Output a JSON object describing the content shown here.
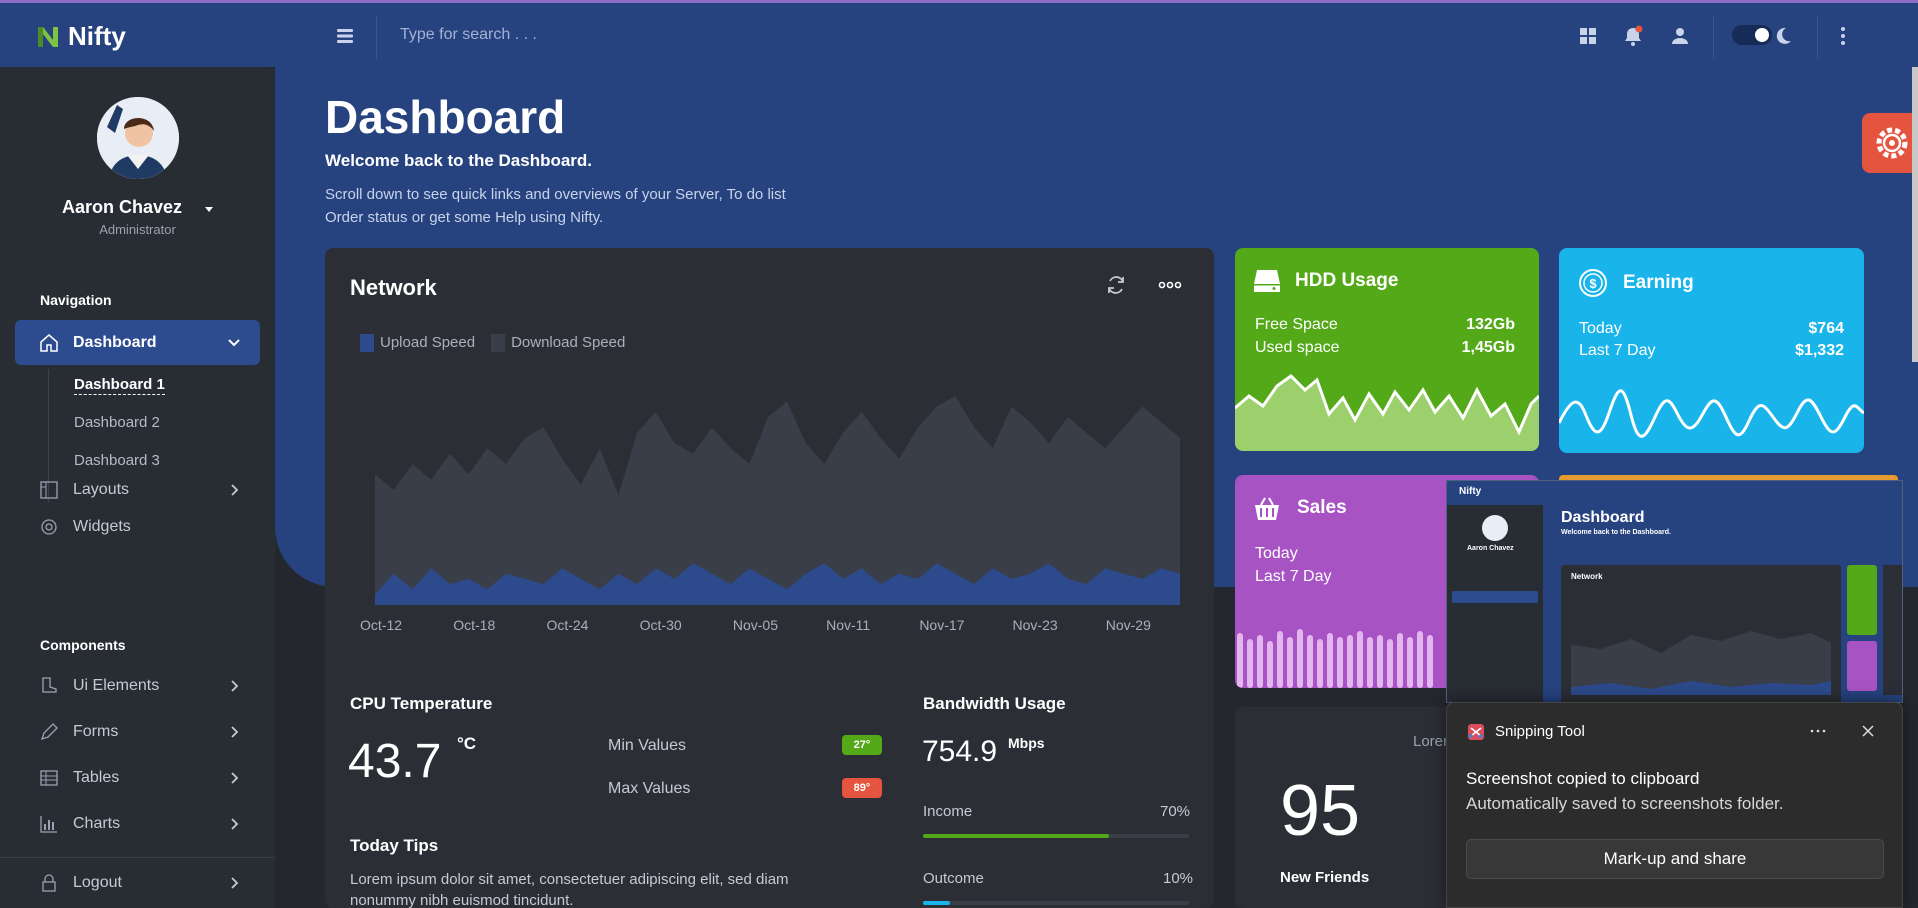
{
  "header": {
    "brand": "Nifty",
    "search_placeholder": "Type for search . . .",
    "icons": [
      "menu-icon",
      "grid-icon",
      "bell-icon",
      "user-icon",
      "theme-toggle",
      "moon-icon",
      "more-vertical-icon"
    ]
  },
  "sidebar": {
    "user_name": "Aaron Chavez",
    "user_role": "Administrator",
    "navigation_title": "Navigation",
    "dashboard_label": "Dashboard",
    "sub_items": [
      "Dashboard 1",
      "Dashboard 2",
      "Dashboard 3"
    ],
    "items": [
      {
        "label": "Layouts",
        "icon": "layout-icon",
        "has_submenu": true
      },
      {
        "label": "Widgets",
        "icon": "widget-icon",
        "has_submenu": false
      }
    ],
    "components_title": "Components",
    "components": [
      {
        "label": "Ui Elements",
        "icon": "boot-icon"
      },
      {
        "label": "Forms",
        "icon": "pen-icon"
      },
      {
        "label": "Tables",
        "icon": "table-icon"
      },
      {
        "label": "Charts",
        "icon": "chart-icon"
      }
    ],
    "logout": "Logout"
  },
  "page": {
    "title": "Dashboard",
    "welcome": "Welcome back to the Dashboard.",
    "desc_line1": "Scroll down to see quick links and overviews of your Server, To do list",
    "desc_line2": "Order status or get some Help using Nifty."
  },
  "network": {
    "title": "Network",
    "legend": [
      "Upload Speed",
      "Download Speed"
    ]
  },
  "chart_data": {
    "type": "area",
    "title": "Network",
    "categories": [
      "Oct-12",
      "Oct-18",
      "Oct-24",
      "Oct-30",
      "Nov-05",
      "Nov-11",
      "Nov-17",
      "Nov-23",
      "Nov-29"
    ],
    "series": [
      {
        "name": "Download Speed",
        "color": "#3a3e48",
        "values": [
          25,
          22,
          27,
          24,
          29,
          25,
          30,
          27,
          32,
          34,
          28,
          23,
          30,
          21,
          33,
          37,
          31,
          29,
          34,
          30,
          27,
          36,
          39,
          31,
          27,
          33,
          37,
          32,
          28,
          34,
          38,
          40,
          34,
          30,
          38,
          35,
          31,
          36,
          33,
          30,
          34,
          38,
          35,
          32
        ]
      },
      {
        "name": "Upload Speed",
        "color": "#2c4a8c",
        "values": [
          2,
          6,
          3,
          7,
          4,
          5,
          3,
          6,
          5,
          4,
          7,
          5,
          3,
          6,
          4,
          7,
          5,
          8,
          6,
          4,
          7,
          5,
          3,
          6,
          8,
          5,
          7,
          4,
          6,
          5,
          8,
          6,
          4,
          7,
          5,
          6,
          8,
          5,
          4,
          7,
          6,
          5,
          7,
          6
        ]
      }
    ],
    "xlabel": "",
    "ylabel": "",
    "legend_placement": "top-left",
    "grid": false
  },
  "cpu": {
    "title": "CPU Temperature",
    "value": "43.7",
    "unit": "°C",
    "min_label": "Min Values",
    "min_badge": "27°",
    "max_label": "Max Values",
    "max_badge": "89°"
  },
  "bandwidth": {
    "title": "Bandwidth Usage",
    "value": "754.9",
    "unit": "Mbps",
    "income_label": "Income",
    "income_pct": "70%",
    "income_fraction": 0.7,
    "outcome_label": "Outcome",
    "outcome_pct": "10%",
    "outcome_fraction": 0.1
  },
  "tips": {
    "title": "Today Tips",
    "line1": "Lorem ipsum dolor sit amet, consectetuer adipiscing elit, sed diam",
    "line2": "nonummy nibh euismod tincidunt."
  },
  "hdd": {
    "title": "HDD Usage",
    "free_label": "Free Space",
    "free_value": "132Gb",
    "used_label": "Used space",
    "used_value": "1,45Gb",
    "color": "#54a919"
  },
  "earning": {
    "title": "Earning",
    "today_label": "Today",
    "today_value": "$764",
    "week_label": "Last 7 Day",
    "week_value": "$1,332",
    "color": "#18b4ea"
  },
  "sales": {
    "title": "Sales",
    "today_label": "Today",
    "week_label": "Last 7 Day",
    "color": "#a853c3"
  },
  "friends": {
    "lorem": "Lorem",
    "count": "95",
    "label": "New Friends"
  },
  "snip_toast": {
    "app": "Snipping Tool",
    "message": "Screenshot copied to clipboard",
    "sub": "Automatically saved to screenshots folder.",
    "button": "Mark-up and share"
  },
  "preview": {
    "brand": "Nifty",
    "title": "Dashboard",
    "welcome": "Welcome back to the Dashboard.",
    "user": "Aaron Chavez",
    "network": "Network"
  }
}
